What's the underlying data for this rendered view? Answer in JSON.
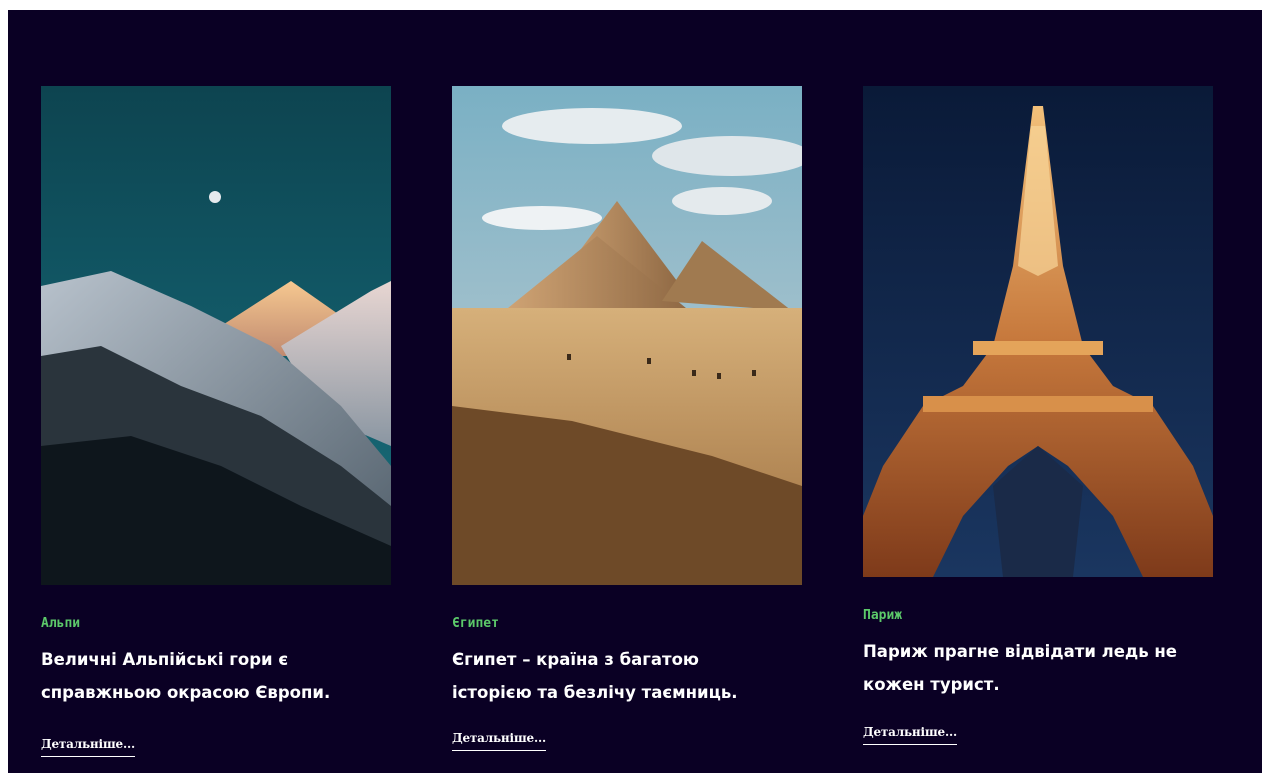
{
  "colors": {
    "background": "#0a0024",
    "accent": "#5cc96a",
    "text": "#ffffff"
  },
  "destinations": [
    {
      "tag": "Альпи",
      "title": "Величні Альпійські гори є справжньою окрасою Європи.",
      "link_label": "Детальніше..."
    },
    {
      "tag": "Єгипет",
      "title": "Єгипет – країна з багатою історією та безлічу таємниць.",
      "link_label": "Детальніше..."
    },
    {
      "tag": "Париж",
      "title": "Париж прагне відвідати ледь не кожен турист.",
      "link_label": "Детальніше..."
    }
  ]
}
